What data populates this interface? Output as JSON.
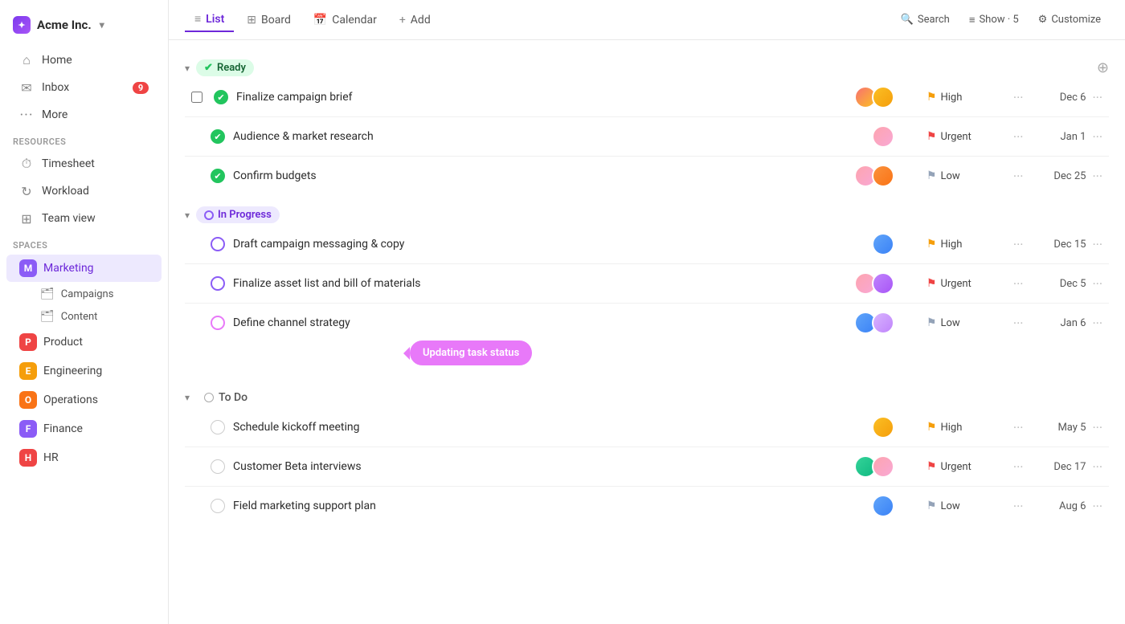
{
  "app": {
    "title": "Acme Inc.",
    "chevron": "▾"
  },
  "sidebar": {
    "nav": [
      {
        "id": "home",
        "label": "Home",
        "icon": "⌂"
      },
      {
        "id": "inbox",
        "label": "Inbox",
        "icon": "✉",
        "badge": "9"
      },
      {
        "id": "more",
        "label": "More",
        "icon": "···"
      }
    ],
    "resources_label": "Resources",
    "resources": [
      {
        "id": "timesheet",
        "label": "Timesheet",
        "icon": "⏱"
      },
      {
        "id": "workload",
        "label": "Workload",
        "icon": "↻"
      },
      {
        "id": "teamview",
        "label": "Team view",
        "icon": "⊞"
      }
    ],
    "spaces_label": "Spaces",
    "spaces": [
      {
        "id": "marketing",
        "label": "Marketing",
        "color": "#8b5cf6",
        "letter": "M",
        "active": true
      },
      {
        "id": "product",
        "label": "Product",
        "color": "#ef4444",
        "letter": "P"
      },
      {
        "id": "engineering",
        "label": "Engineering",
        "color": "#f59e0b",
        "letter": "E"
      },
      {
        "id": "operations",
        "label": "Operations",
        "color": "#f97316",
        "letter": "O"
      },
      {
        "id": "finance",
        "label": "Finance",
        "color": "#8b5cf6",
        "letter": "F"
      },
      {
        "id": "hr",
        "label": "HR",
        "color": "#ef4444",
        "letter": "H"
      }
    ],
    "sub_items": [
      {
        "id": "campaigns",
        "label": "Campaigns"
      },
      {
        "id": "content",
        "label": "Content"
      }
    ]
  },
  "topbar": {
    "tabs": [
      {
        "id": "list",
        "label": "List",
        "icon": "≡",
        "active": true
      },
      {
        "id": "board",
        "label": "Board",
        "icon": "⊞"
      },
      {
        "id": "calendar",
        "label": "Calendar",
        "icon": "📅"
      },
      {
        "id": "add",
        "label": "Add",
        "icon": "+"
      }
    ],
    "actions": [
      {
        "id": "search",
        "label": "Search",
        "icon": "🔍"
      },
      {
        "id": "show",
        "label": "Show · 5",
        "icon": "≡"
      },
      {
        "id": "customize",
        "label": "Customize",
        "icon": "⚙"
      }
    ]
  },
  "sections": [
    {
      "id": "ready",
      "label": "Ready",
      "type": "ready",
      "tasks": [
        {
          "id": "t1",
          "name": "Finalize campaign brief",
          "status": "done",
          "avatars": [
            "#e88",
            "#da8"
          ],
          "priority": "High",
          "priority_type": "high",
          "dots": true,
          "date": "Dec 6",
          "has_checkbox": true
        },
        {
          "id": "t2",
          "name": "Audience & market research",
          "status": "done",
          "avatars": [
            "#e8a0bf"
          ],
          "priority": "Urgent",
          "priority_type": "urgent",
          "dots": true,
          "date": "Jan 1"
        },
        {
          "id": "t3",
          "name": "Confirm budgets",
          "status": "done",
          "avatars": [
            "#f8b4a8",
            "#c084fc"
          ],
          "priority": "Low",
          "priority_type": "low",
          "dots": true,
          "date": "Dec 25"
        }
      ]
    },
    {
      "id": "in-progress",
      "label": "In Progress",
      "type": "in-progress",
      "tasks": [
        {
          "id": "t4",
          "name": "Draft campaign messaging & copy",
          "status": "inprogress",
          "avatars": [
            "#60a5fa"
          ],
          "priority": "High",
          "priority_type": "high",
          "dots": true,
          "date": "Dec 15"
        },
        {
          "id": "t5",
          "name": "Finalize asset list and bill of materials",
          "status": "inprogress",
          "avatars": [
            "#fda4af",
            "#c084fc"
          ],
          "priority": "Urgent",
          "priority_type": "urgent",
          "dots": true,
          "date": "Dec 5"
        },
        {
          "id": "t6",
          "name": "Define channel strategy",
          "status": "inprogress",
          "avatars": [
            "#60a5fa",
            "#d8b4fe"
          ],
          "priority": "Low",
          "priority_type": "low",
          "dots": true,
          "date": "Jan 6",
          "tooltip": "Updating task status"
        }
      ]
    },
    {
      "id": "todo",
      "label": "To Do",
      "type": "todo",
      "tasks": [
        {
          "id": "t7",
          "name": "Schedule kickoff meeting",
          "status": "empty",
          "avatars": [
            "#fbbf24"
          ],
          "priority": "High",
          "priority_type": "high",
          "dots": true,
          "date": "May 5"
        },
        {
          "id": "t8",
          "name": "Customer Beta interviews",
          "status": "empty",
          "avatars": [
            "#34d399",
            "#fda4af"
          ],
          "priority": "Urgent",
          "priority_type": "urgent",
          "dots": true,
          "date": "Dec 17"
        },
        {
          "id": "t9",
          "name": "Field marketing support plan",
          "status": "empty",
          "avatars": [
            "#60a5fa"
          ],
          "priority": "Low",
          "priority_type": "low",
          "dots": true,
          "date": "Aug 6"
        }
      ]
    }
  ],
  "tooltip": {
    "label": "Updating task status"
  }
}
